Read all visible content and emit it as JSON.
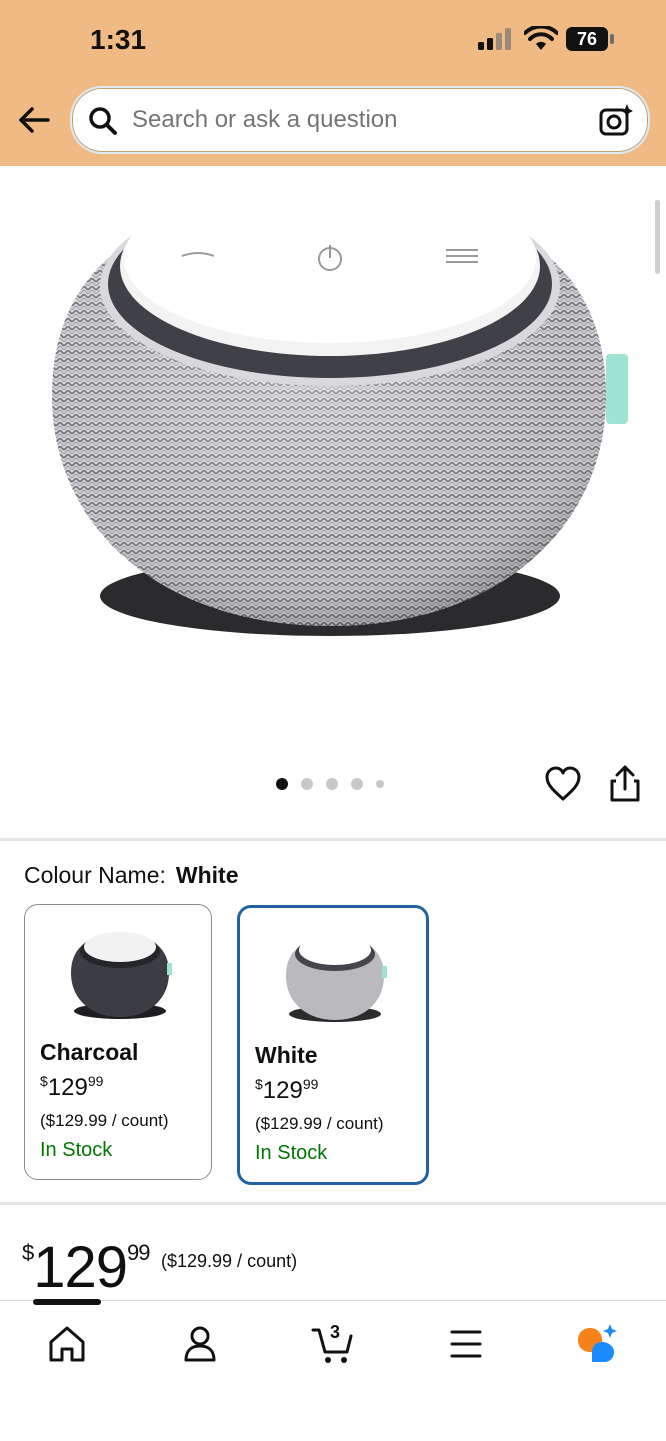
{
  "status_bar": {
    "time": "1:31",
    "battery": "76"
  },
  "search": {
    "placeholder": "Search or ask a question"
  },
  "gallery": {
    "dot_count": 5,
    "active_index": 0
  },
  "variant_selector": {
    "label": "Colour Name:",
    "selected": "White",
    "options": [
      {
        "name": "Charcoal",
        "price_currency": "$",
        "price_whole": "129",
        "price_cents": "99",
        "unit_price": "($129.99 / count)",
        "stock": "In Stock"
      },
      {
        "name": "White",
        "price_currency": "$",
        "price_whole": "129",
        "price_cents": "99",
        "unit_price": "($129.99 / count)",
        "stock": "In Stock"
      }
    ]
  },
  "price": {
    "currency": "$",
    "whole": "129",
    "cents": "99",
    "unit": "($129.99 / count)"
  },
  "cart": {
    "count": "3"
  },
  "colors": {
    "header_bg": "#efba83",
    "selected_border": "#2162a1",
    "in_stock": "#007600"
  }
}
